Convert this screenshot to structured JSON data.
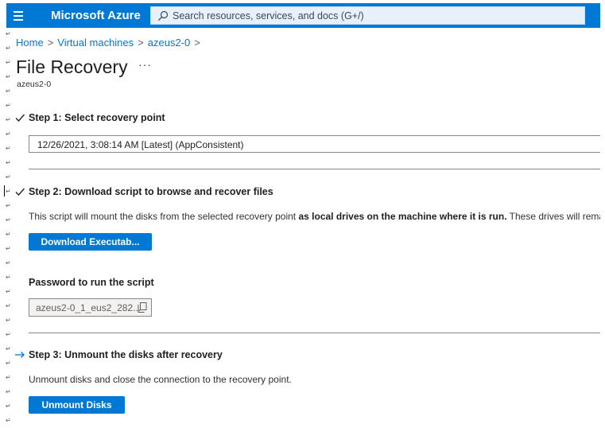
{
  "topbar": {
    "brand": "Microsoft Azure",
    "search_placeholder": "Search resources, services, and docs (G+/)"
  },
  "breadcrumb": {
    "items": [
      "Home",
      "Virtual machines",
      "azeus2-0"
    ],
    "separator": ">"
  },
  "page": {
    "title": "File Recovery",
    "more_label": "···",
    "subtitle": "azeus2-0"
  },
  "step1": {
    "heading": "Step 1: Select recovery point",
    "recovery_point": "12/26/2021, 3:08:14 AM [Latest] (AppConsistent)"
  },
  "step2": {
    "heading": "Step 2: Download script to browse and recover files",
    "desc_prefix": "This script will mount the disks from the selected recovery point ",
    "desc_bold": "as local drives on the machine where it is run.",
    "desc_suffix": " These drives will remain",
    "download_label": "Download Executab...",
    "password_label": "Password to run the script",
    "password_value": "azeus2-0_1_eus2_282..."
  },
  "step3": {
    "heading": "Step 3: Unmount the disks after recovery",
    "description": "Unmount disks and close the connection to the recovery point.",
    "unmount_label": "Unmount Disks"
  },
  "formatting_mark": "↵",
  "colors": {
    "azure_blue": "#0078d4",
    "search_bg": "#e8f1fb",
    "text": "#201f1e",
    "divider": "#8a8886"
  },
  "icons": [
    "hamburger-icon",
    "search-icon",
    "checkmark-icon",
    "arrow-right-icon",
    "copy-icon",
    "more-icon"
  ]
}
